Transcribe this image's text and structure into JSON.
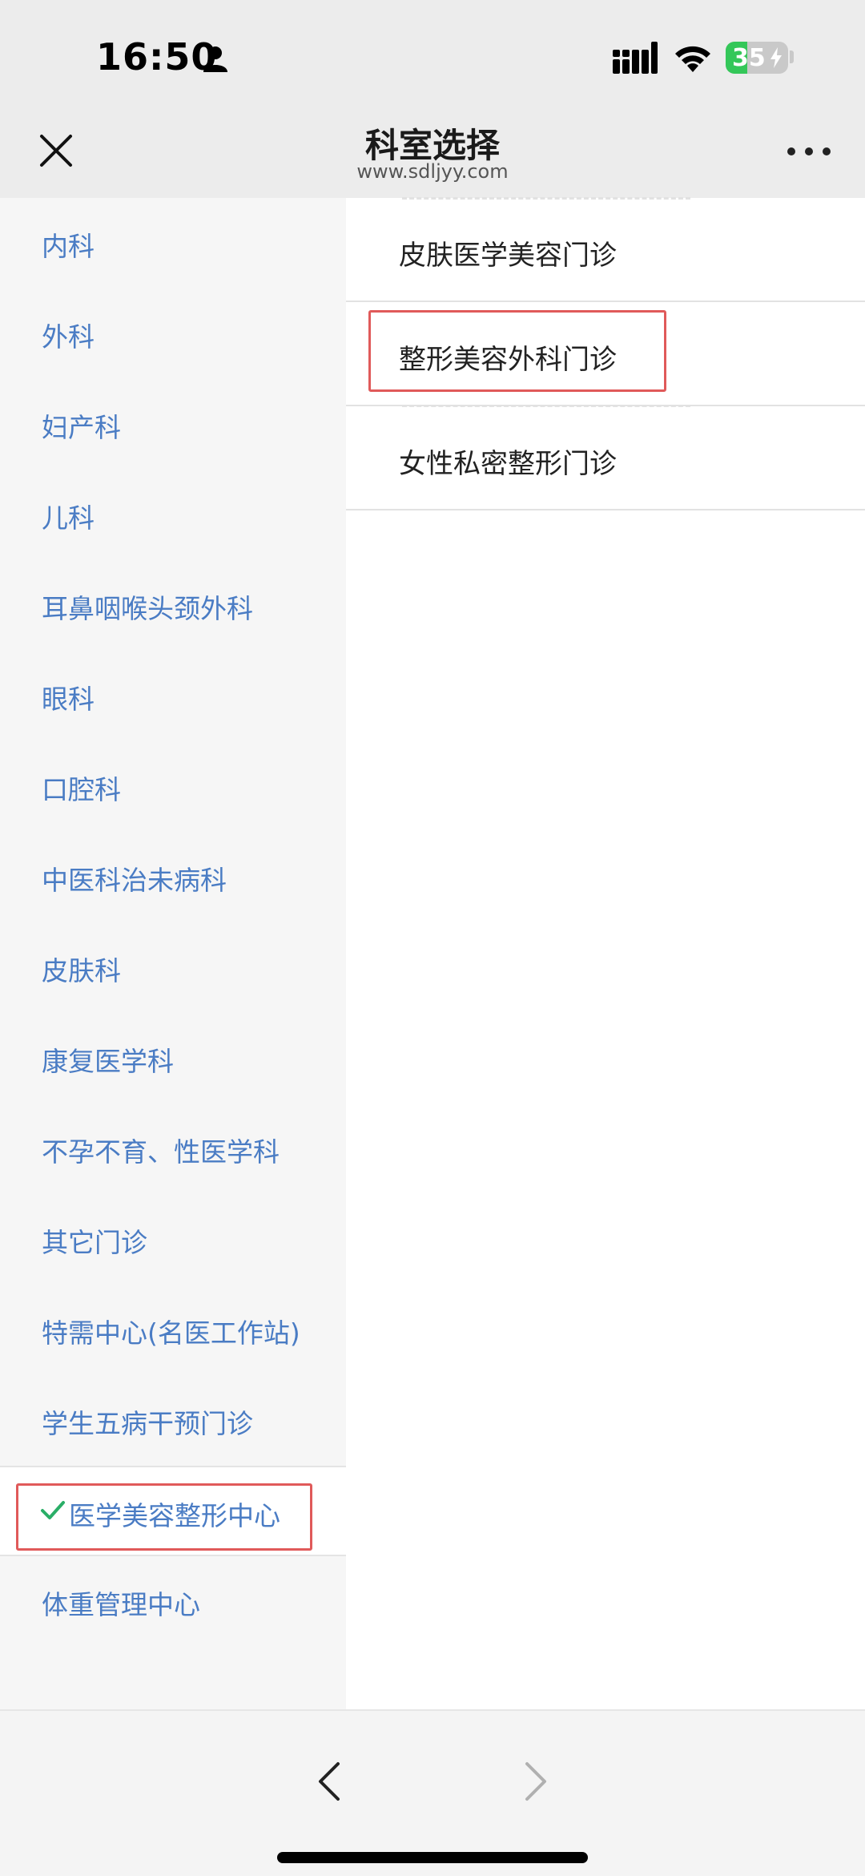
{
  "status_bar": {
    "time": "16:50",
    "battery_level": "35",
    "battery_fill_fraction": 0.35,
    "icons": [
      "person-icon",
      "cellular-signal-icon",
      "wifi-icon",
      "battery-charging-icon"
    ]
  },
  "header": {
    "title": "科室选择",
    "subtitle": "www.sdljyy.com",
    "close_icon": "close-icon",
    "more_icon": "more-icon"
  },
  "departments": [
    {
      "label": "内科"
    },
    {
      "label": "外科"
    },
    {
      "label": "妇产科"
    },
    {
      "label": "儿科"
    },
    {
      "label": "耳鼻咽喉头颈外科"
    },
    {
      "label": "眼科"
    },
    {
      "label": "口腔科"
    },
    {
      "label": "中医科治未病科"
    },
    {
      "label": "皮肤科"
    },
    {
      "label": "康复医学科"
    },
    {
      "label": "不孕不育、性医学科"
    },
    {
      "label": "其它门诊"
    },
    {
      "label": "特需中心(名医工作站)"
    },
    {
      "label": "学生五病干预门诊"
    },
    {
      "label": "医学美容整形中心",
      "selected": true
    },
    {
      "label": "体重管理中心"
    }
  ],
  "clinics": [
    {
      "label": "皮肤医学美容门诊"
    },
    {
      "label": "整形美容外科门诊",
      "highlighted": true
    },
    {
      "label": "女性私密整形门诊"
    }
  ],
  "toolbar": {
    "back_icon": "chevron-left-icon",
    "forward_icon": "chevron-right-icon"
  },
  "colors": {
    "department_text": "#4a7cc4",
    "check_green": "#2aae67",
    "highlight_red": "#e05a5a",
    "battery_green": "#34c759"
  }
}
